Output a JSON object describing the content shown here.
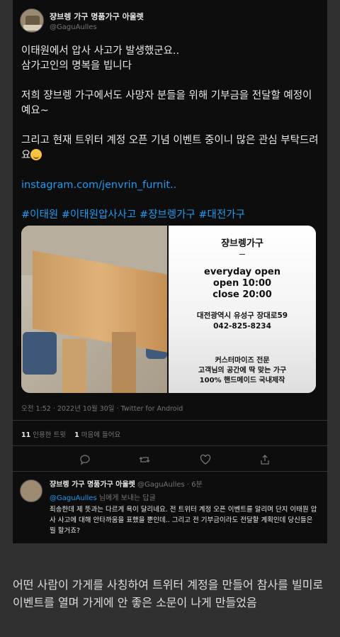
{
  "tweet": {
    "display_name": "쟝브렝 가구 명품가구 아울렛",
    "handle": "@GaguAulles",
    "lines": [
      "이태원에서 압사 사고가 발생했군요..",
      "삼가고인의 명복을 빕니다",
      "저희 쟝브렝 가구에서도 사망자 분들을 위해 기부금을 전달할 예정이예요~",
      "그리고 현재 트위터 계정 오픈 기념 이벤트 중이니 많은 관심 부탁드려요"
    ],
    "link": "instagram.com/jenvrin_furnit..",
    "hashtags": "#이태원 #이태원압사사고 #쟝브렝가구 #대전가구",
    "media": {
      "brand": "쟝브렝가구",
      "hours_1": "everyday open",
      "hours_2": "open 10:00",
      "hours_3": "close 20:00",
      "address": "대전광역시 유성구 장대로59",
      "phone": "042-825-8234",
      "tag_1": "커스터마이즈 전문",
      "tag_2": "고객님의 공간에 딱 맞는 가구",
      "tag_3": "100% 핸드메이드 국내제작"
    },
    "meta": "오전 1:52 · 2022년 10월 30일 · Twitter for Android",
    "quote_count": "11",
    "quote_label": "인용한 트윗",
    "like_count": "1",
    "like_label": "마음에 들어요"
  },
  "reply": {
    "display_name": "쟝브렝 가구 명품가구 아울렛",
    "handle_time": "@GaguAulles · 6분",
    "to_handle": "@GaguAulles",
    "to_suffix": "님에게 보내는 답글",
    "text": "죄송한데 제 뜻과는 다르게 욕이 달리네요. 전 트위터 계정 오픈 이벤트를 알리며 단지 이태원 압사 사고에 대해 안타까움을 표했을 뿐인데.. 그리고 전 기부금이라도 전달할 계획인데 당신들은 뭘 할거죠?"
  },
  "caption": "어떤 사람이 가게를 사칭하여 트위터 계정을 만들어 참사를 빌미로 이벤트를 열며 가게에 안 좋은 소문이 나게 만들었음",
  "colors": {
    "link": "#1d9bf0",
    "bg": "#0d0d0d",
    "text": "#e7e9ea",
    "muted": "#71767b"
  }
}
